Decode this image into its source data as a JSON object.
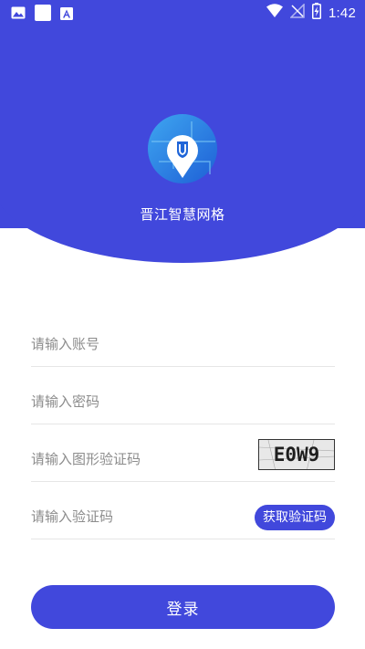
{
  "colors": {
    "primary": "#4148dc",
    "white": "#ffffff",
    "placeholder": "#8c8c8c",
    "divider": "#e6e6e6"
  },
  "status_bar": {
    "time": "1:42",
    "left_icons": [
      "image-icon",
      "square-icon",
      "font-icon"
    ],
    "right_icons": [
      "wifi-icon",
      "no-signal-icon",
      "battery-charging-icon"
    ]
  },
  "header": {
    "app_title": "晋江智慧网格",
    "logo_icon": "location-pin-shield-icon"
  },
  "form": {
    "account_placeholder": "请输入账号",
    "password_placeholder": "请输入密码",
    "captcha_placeholder": "请输入图形验证码",
    "captcha_image_text": "E0W9",
    "sms_placeholder": "请输入验证码",
    "sms_button_label": "获取验证码",
    "login_button_label": "登录"
  }
}
